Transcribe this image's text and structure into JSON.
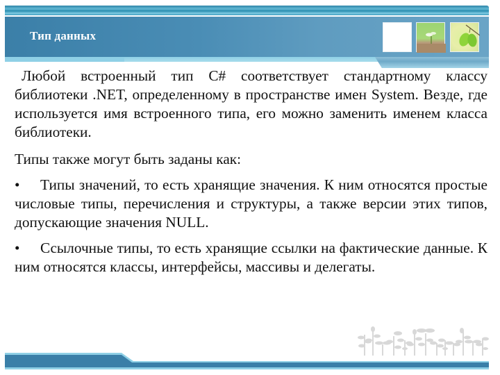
{
  "slide": {
    "title": "Тип данных",
    "paragraphs": [
      "Любой встроенный тип C# соответствует стандартному классу библиотеки .NET, определенному в пространстве имен System. Везде, где используется имя встроенного типа, его можно заменить именем класса библиотеки.",
      "Типы также могут быть заданы как:"
    ],
    "bullets": [
      {
        "marker": "•",
        "text": "Типы значений, то есть хранящие значения. К ним относятся простые числовые типы, перечисления и структуры, а также версии этих типов, допускающие значения NULL."
      },
      {
        "marker": "•",
        "text": "Ссылочные типы, то есть хранящие ссылки на фактические данные. К ним относятся классы, интерфейсы, массивы и делегаты."
      }
    ],
    "header_images": [
      "blank-image",
      "sprout-image",
      "leaves-image"
    ],
    "decoration": "plants-silhouette",
    "colors": {
      "header_band": "#4a8db5",
      "accent_light": "#8fd0e6",
      "bottom_bar": "#3a7fa8",
      "plants": "#d8d8d8",
      "text": "#111111",
      "title_text": "#ffffff"
    }
  }
}
